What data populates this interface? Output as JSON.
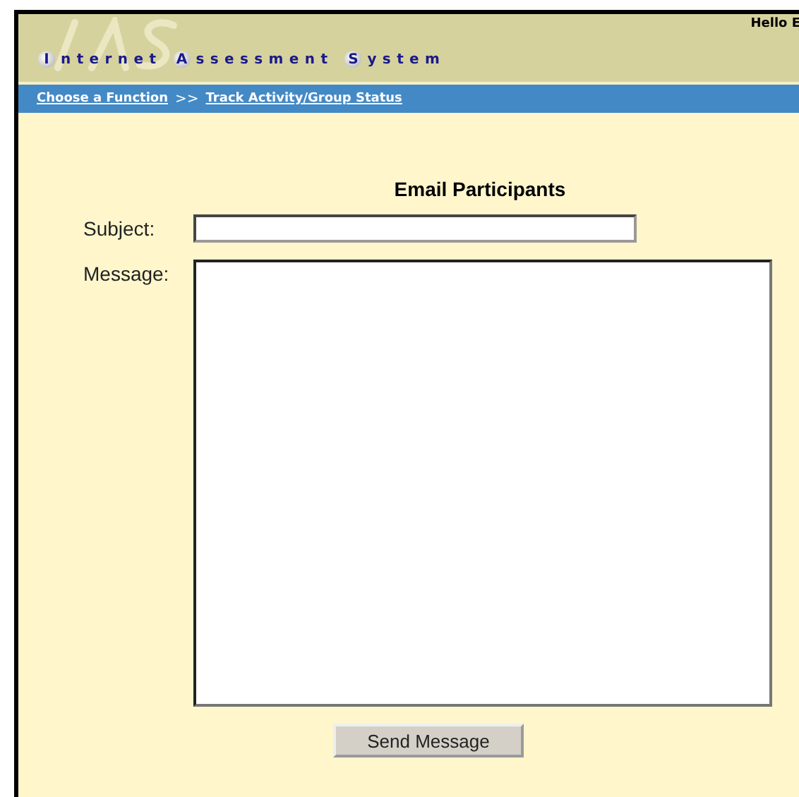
{
  "header": {
    "greeting": "Hello E",
    "title_words": [
      {
        "initial": "I",
        "rest": "nternet"
      },
      {
        "initial": "A",
        "rest": "ssessment"
      },
      {
        "initial": "S",
        "rest": "ystem"
      }
    ]
  },
  "breadcrumb": {
    "links": [
      "Choose a Function",
      "Track Activity/Group Status"
    ],
    "separator": ">>"
  },
  "form": {
    "heading": "Email Participants",
    "subject_label": "Subject:",
    "message_label": "Message:",
    "submit": "Send Message"
  }
}
